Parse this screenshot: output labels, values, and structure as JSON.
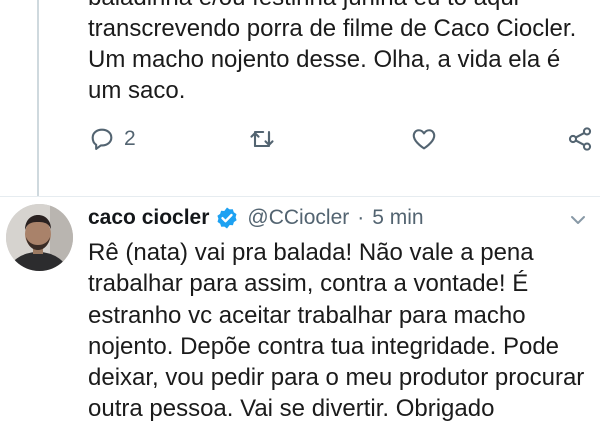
{
  "previous_tweet": {
    "text": "baladinha e/ou festinha junina eu tô aqui\ntranscrevendo porra de filme de Caco Ciocler.\nUm macho nojento desse. Olha, a vida ela é\num saco.",
    "actions": {
      "reply_count": "2",
      "icons": [
        "reply-icon",
        "retweet-icon",
        "like-icon",
        "share-icon"
      ]
    }
  },
  "tweet": {
    "display_name": "caco ciocler",
    "handle": "@CCiocler",
    "separator": "·",
    "time": "5 min",
    "text": "Rê (nata) vai pra balada! Não vale a pena trabalhar para assim, contra a vontade! É estranho vc aceitar trabalhar para macho nojento. Depõe contra tua integridade. Pode deixar, vou pedir para o meu produtor procurar outra pessoa. Vai se divertir. Obrigado"
  },
  "colors": {
    "verified_badge": "#1da1f2",
    "icon_gray": "#536471",
    "text": "#1b1b1b"
  }
}
